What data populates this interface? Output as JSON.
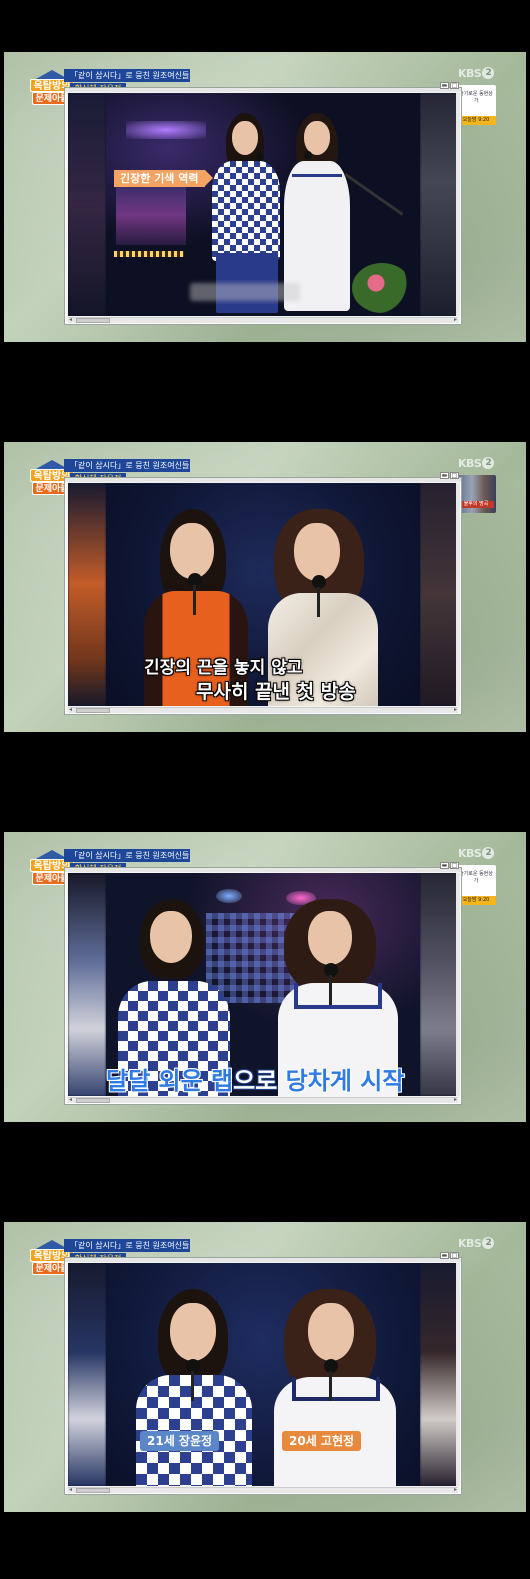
{
  "show": {
    "logo_line1": "옥탑방의",
    "logo_line2": "문제아들",
    "topic": "「같이 삽시다」로 뭉친 원조여신들",
    "names": "황신혜 장윤정",
    "channel": "KBS",
    "channel_num": "2"
  },
  "promos": {
    "panel1": {
      "text": "슬기로운 동현상가",
      "time": "오늘밤 9:20"
    },
    "panel2": {
      "caption": "불후의 명곡"
    },
    "panel3": {
      "text": "슬기로운 동현상가",
      "time": "오늘밤 9:20"
    }
  },
  "frames": [
    {
      "caption": "긴장한 기색 역력"
    },
    {
      "line1": "긴장의 끈을 놓지 않고",
      "line2": "무사히 끝낸 첫 방송"
    },
    {
      "part1": "달달 외운 랩",
      "part2": "으로",
      "part3": "당차게 시작"
    },
    {
      "left_label": "21세 장윤정",
      "right_label": "20세 고현정"
    }
  ],
  "colors": {
    "panel_bg": "#b3c5aa",
    "topic_bar": "#1e4799",
    "accent_orange": "#f3a463",
    "subtitle_blue": "#2e7be5"
  }
}
